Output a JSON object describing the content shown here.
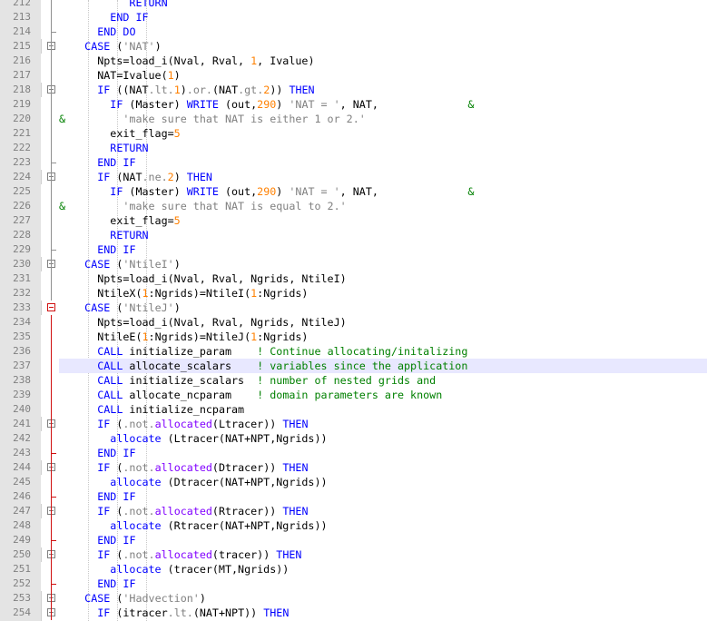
{
  "editor": {
    "language": "fortran",
    "current_line": 237,
    "caret": {
      "line": 237,
      "column": 4
    },
    "colors": {
      "keyword": "#0000ff",
      "intrinsic": "#8000ff",
      "string": "#808080",
      "number": "#ff8000",
      "operator": "#808080",
      "comment": "#008000",
      "line_number": "#808080",
      "gutter_background": "#e4e4e4",
      "current_line_background": "#e8e8ff",
      "fold_marker_red": "#d01010"
    },
    "lines": [
      {
        "n": "212",
        "t": "           RETURN",
        "fold": "none"
      },
      {
        "n": "213",
        "t": "        END IF",
        "fold": "none"
      },
      {
        "n": "214",
        "t": "      END DO",
        "fold": "none"
      },
      {
        "n": "215",
        "t": "    CASE ('NAT')",
        "fold": "open"
      },
      {
        "n": "216",
        "t": "      Npts=load_i(Nval, Rval, 1, Ivalue)",
        "fold": "none"
      },
      {
        "n": "217",
        "t": "      NAT=Ivalue(1)",
        "fold": "none"
      },
      {
        "n": "218",
        "t": "      IF ((NAT.lt.1).or.(NAT.gt.2)) THEN",
        "fold": "open"
      },
      {
        "n": "219",
        "t": "        IF (Master) WRITE (out,290) 'NAT = ', NAT,              &",
        "fold": "none"
      },
      {
        "n": "220",
        "t": "&         'make sure that NAT is either 1 or 2.'",
        "fold": "none"
      },
      {
        "n": "221",
        "t": "        exit_flag=5",
        "fold": "none"
      },
      {
        "n": "222",
        "t": "        RETURN",
        "fold": "none"
      },
      {
        "n": "223",
        "t": "      END IF",
        "fold": "none"
      },
      {
        "n": "224",
        "t": "      IF (NAT.ne.2) THEN",
        "fold": "open"
      },
      {
        "n": "225",
        "t": "        IF (Master) WRITE (out,290) 'NAT = ', NAT,              &",
        "fold": "none"
      },
      {
        "n": "226",
        "t": "&         'make sure that NAT is equal to 2.'",
        "fold": "none"
      },
      {
        "n": "227",
        "t": "        exit_flag=5",
        "fold": "none"
      },
      {
        "n": "228",
        "t": "        RETURN",
        "fold": "none"
      },
      {
        "n": "229",
        "t": "      END IF",
        "fold": "none"
      },
      {
        "n": "230",
        "t": "    CASE ('NtileI')",
        "fold": "open"
      },
      {
        "n": "231",
        "t": "      Npts=load_i(Nval, Rval, Ngrids, NtileI)",
        "fold": "none"
      },
      {
        "n": "232",
        "t": "      NtileX(1:Ngrids)=NtileI(1:Ngrids)",
        "fold": "none"
      },
      {
        "n": "233",
        "t": "    CASE ('NtileJ')",
        "fold": "open-red"
      },
      {
        "n": "234",
        "t": "      Npts=load_i(Nval, Rval, Ngrids, NtileJ)",
        "fold": "none"
      },
      {
        "n": "235",
        "t": "      NtileE(1:Ngrids)=NtileJ(1:Ngrids)",
        "fold": "none"
      },
      {
        "n": "236",
        "t": "      CALL initialize_param    ! Continue allocating/initalizing",
        "fold": "none"
      },
      {
        "n": "237",
        "t": "      CALL allocate_scalars    ! variables since the application",
        "fold": "none"
      },
      {
        "n": "238",
        "t": "      CALL initialize_scalars  ! number of nested grids and",
        "fold": "none"
      },
      {
        "n": "239",
        "t": "      CALL allocate_ncparam    ! domain parameters are known",
        "fold": "none"
      },
      {
        "n": "240",
        "t": "      CALL initialize_ncparam",
        "fold": "none"
      },
      {
        "n": "241",
        "t": "      IF (.not.allocated(Ltracer)) THEN",
        "fold": "open"
      },
      {
        "n": "242",
        "t": "        allocate (Ltracer(NAT+NPT,Ngrids))",
        "fold": "none"
      },
      {
        "n": "243",
        "t": "      END IF",
        "fold": "none"
      },
      {
        "n": "244",
        "t": "      IF (.not.allocated(Dtracer)) THEN",
        "fold": "open"
      },
      {
        "n": "245",
        "t": "        allocate (Dtracer(NAT+NPT,Ngrids))",
        "fold": "none"
      },
      {
        "n": "246",
        "t": "      END IF",
        "fold": "none"
      },
      {
        "n": "247",
        "t": "      IF (.not.allocated(Rtracer)) THEN",
        "fold": "open"
      },
      {
        "n": "248",
        "t": "        allocate (Rtracer(NAT+NPT,Ngrids))",
        "fold": "none"
      },
      {
        "n": "249",
        "t": "      END IF",
        "fold": "none"
      },
      {
        "n": "250",
        "t": "      IF (.not.allocated(tracer)) THEN",
        "fold": "open"
      },
      {
        "n": "251",
        "t": "        allocate (tracer(MT,Ngrids))",
        "fold": "none"
      },
      {
        "n": "252",
        "t": "      END IF",
        "fold": "none"
      },
      {
        "n": "253",
        "t": "    CASE ('Hadvection')",
        "fold": "open"
      },
      {
        "n": "254",
        "t": "      IF (itracer.lt.(NAT+NPT)) THEN",
        "fold": "open"
      }
    ]
  }
}
